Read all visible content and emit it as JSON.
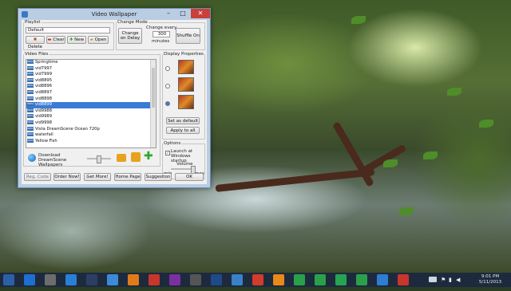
{
  "window": {
    "title": "Video Wallpaper",
    "titlebar_buttons": [
      "–",
      "□",
      "✕"
    ]
  },
  "playlist": {
    "legend": "Playlist",
    "selected": "Default",
    "buttons": {
      "delete": "Delete",
      "clear": "Clear",
      "new": "New",
      "open": "Open"
    }
  },
  "change_mode": {
    "legend": "Change Mode",
    "change_on_delay": "Change on Delay",
    "change_every_label": "Change every",
    "interval_value": "300",
    "minutes_label": "minutes",
    "shuffle": "Shuffle On"
  },
  "video_files": {
    "legend": "Video Files",
    "items": [
      "Springtime",
      "vid7997",
      "vid7999",
      "vid8895",
      "vid8896",
      "vid8897",
      "vid8898",
      "vid8899",
      "vid9988",
      "vid9989",
      "vid9998",
      "Vista DreamScene Ocean 720p",
      "waterfall",
      "Yellow Fish"
    ],
    "selected_index": 7,
    "file_badge": "WMV"
  },
  "display_properties": {
    "legend": "Display Properties",
    "set_default": "Set as default",
    "apply_all": "Apply to all"
  },
  "options": {
    "legend": "Options",
    "launch_startup": "Launch at Windows startup",
    "launch_checked": true,
    "volume": "Volume",
    "min": "min",
    "max": "max"
  },
  "download": {
    "label": "Download DreamScene Wallpapers"
  },
  "bottom_buttons": [
    "Reg. Code",
    "Order Now!",
    "Get More!",
    "Home Page",
    "Suggestion",
    "OK"
  ],
  "tray": {
    "time": "9:01 PM",
    "date": "5/11/2013"
  },
  "taskbar_icons": [
    "start-icon",
    "calendar-icon",
    "chart-icon",
    "water-drop-icon",
    "terminal-icon",
    "folder-icon",
    "vlc-icon",
    "ppt-icon",
    "media-icon",
    "hardware-icon",
    "photoshop-icon",
    "kmplayer-icon",
    "chrome-icon",
    "firefox-icon",
    "whatsapp-icon",
    "phone-icon",
    "maps-icon",
    "chat-icon",
    "windows-icon",
    "pdf-icon"
  ],
  "colors": {
    "selection": "#3b7bd6",
    "taskbar": "#1d2a3e",
    "window_frame": "#b9cde3",
    "close_button": "#c9403a"
  }
}
